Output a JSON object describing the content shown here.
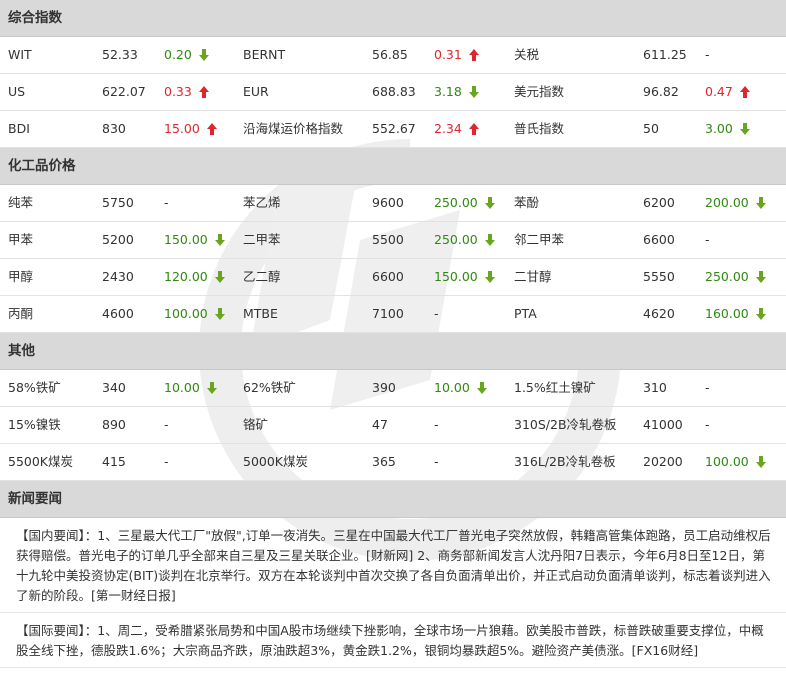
{
  "sections": {
    "indices": {
      "title": "综合指数",
      "rows": [
        [
          {
            "name": "WIT",
            "value": "52.33",
            "change": "0.20",
            "dir": "down"
          },
          {
            "name": "BERNT",
            "value": "56.85",
            "change": "0.31",
            "dir": "up"
          },
          {
            "name": "关税",
            "value": "611.25",
            "change": "-",
            "dir": "none"
          }
        ],
        [
          {
            "name": "US",
            "value": "622.07",
            "change": "0.33",
            "dir": "up"
          },
          {
            "name": "EUR",
            "value": "688.83",
            "change": "3.18",
            "dir": "down"
          },
          {
            "name": "美元指数",
            "value": "96.82",
            "change": "0.47",
            "dir": "up"
          }
        ],
        [
          {
            "name": "BDI",
            "value": "830",
            "change": "15.00",
            "dir": "up"
          },
          {
            "name": "沿海煤运价格指数",
            "value": "552.67",
            "change": "2.34",
            "dir": "up"
          },
          {
            "name": "普氏指数",
            "value": "50",
            "change": "3.00",
            "dir": "down"
          }
        ]
      ]
    },
    "chemicals": {
      "title": "化工品价格",
      "rows": [
        [
          {
            "name": "纯苯",
            "value": "5750",
            "change": "-",
            "dir": "none"
          },
          {
            "name": "苯乙烯",
            "value": "9600",
            "change": "250.00",
            "dir": "down"
          },
          {
            "name": "苯酚",
            "value": "6200",
            "change": "200.00",
            "dir": "down"
          }
        ],
        [
          {
            "name": "甲苯",
            "value": "5200",
            "change": "150.00",
            "dir": "down"
          },
          {
            "name": "二甲苯",
            "value": "5500",
            "change": "250.00",
            "dir": "down"
          },
          {
            "name": "邻二甲苯",
            "value": "6600",
            "change": "-",
            "dir": "none"
          }
        ],
        [
          {
            "name": "甲醇",
            "value": "2430",
            "change": "120.00",
            "dir": "down"
          },
          {
            "name": "乙二醇",
            "value": "6600",
            "change": "150.00",
            "dir": "down"
          },
          {
            "name": "二甘醇",
            "value": "5550",
            "change": "250.00",
            "dir": "down"
          }
        ],
        [
          {
            "name": "丙酮",
            "value": "4600",
            "change": "100.00",
            "dir": "down"
          },
          {
            "name": "MTBE",
            "value": "7100",
            "change": "-",
            "dir": "none"
          },
          {
            "name": "PTA",
            "value": "4620",
            "change": "160.00",
            "dir": "down"
          }
        ]
      ]
    },
    "others": {
      "title": "其他",
      "rows": [
        [
          {
            "name": "58%铁矿",
            "value": "340",
            "change": "10.00",
            "dir": "down"
          },
          {
            "name": "62%铁矿",
            "value": "390",
            "change": "10.00",
            "dir": "down"
          },
          {
            "name": "1.5%红土镍矿",
            "value": "310",
            "change": "-",
            "dir": "none"
          }
        ],
        [
          {
            "name": "15%镍铁",
            "value": "890",
            "change": "-",
            "dir": "none"
          },
          {
            "name": "铬矿",
            "value": "47",
            "change": "-",
            "dir": "none"
          },
          {
            "name": "310S/2B冷轧卷板",
            "value": "41000",
            "change": "-",
            "dir": "none"
          }
        ],
        [
          {
            "name": "5500K煤炭",
            "value": "415",
            "change": "-",
            "dir": "none"
          },
          {
            "name": "5000K煤炭",
            "value": "365",
            "change": "-",
            "dir": "none"
          },
          {
            "name": "316L/2B冷轧卷板",
            "value": "20200",
            "change": "100.00",
            "dir": "down"
          }
        ]
      ]
    }
  },
  "news": {
    "title": "新闻要闻",
    "domestic": "【国内要闻】：1、三星最大代工厂\"放假\",订单一夜消失。三星在中国最大代工厂普光电子突然放假，韩籍高管集体跑路，员工启动维权后获得赔偿。普光电子的订单几乎全部来自三星及三星关联企业。[财新网] 2、商务部新闻发言人沈丹阳7日表示，今年6月8日至12日，第十九轮中美投资协定(BIT)谈判在北京举行。双方在本轮谈判中首次交换了各自负面清单出价，并正式启动负面清单谈判，标志着谈判进入了新的阶段。[第一财经日报]",
    "international": "【国际要闻】：1、周二，受希腊紧张局势和中国A股市场继续下挫影响，全球市场一片狼藉。欧美股市普跌，标普跌破重要支撑位，中概股全线下挫，德股跌1.6%；大宗商品齐跌，原油跌超3%，黄金跌1.2%，银铜均暴跌超5%。避险资产美债涨。[FX16财经]"
  },
  "colors": {
    "up": "#e0262d",
    "down": "#2f8a11",
    "header_bg": "#d9d9d9"
  },
  "icons": {
    "up": "red-up-arrow-icon",
    "down": "green-down-arrow-icon"
  }
}
